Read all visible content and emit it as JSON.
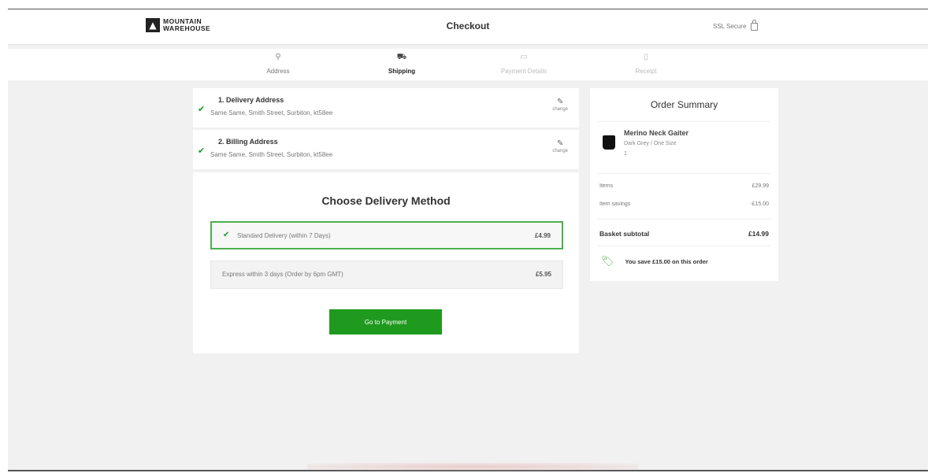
{
  "header": {
    "logo_line1": "MOUNTAIN",
    "logo_line2": "WAREHOUSE",
    "title": "Checkout",
    "secure_label": "SSL Secure"
  },
  "steps": [
    {
      "label": "Address",
      "icon": "location-pin-icon",
      "state": "done"
    },
    {
      "label": "Shipping",
      "icon": "truck-icon",
      "state": "active"
    },
    {
      "label": "Payment Details",
      "icon": "card-icon",
      "state": "inactive"
    },
    {
      "label": "Receipt",
      "icon": "receipt-icon",
      "state": "inactive"
    }
  ],
  "addresses": [
    {
      "title": "1. Delivery Address",
      "text": "Same Same, Smith Street, Surbiton, kt58ee",
      "edit": "change"
    },
    {
      "title": "2. Billing Address",
      "text": "Same Same, Smith Street, Surbiton, kt58ee",
      "edit": "change"
    }
  ],
  "delivery": {
    "title": "Choose Delivery Method",
    "options": [
      {
        "label": "Standard Delivery (within 7 Days)",
        "price": "£4.99",
        "selected": true
      },
      {
        "label": "Express within 3 days (Order by 6pm GMT)",
        "price": "£5.95",
        "selected": false
      }
    ],
    "button_label": "Go to Payment"
  },
  "summary": {
    "title": "Order Summary",
    "product": {
      "name": "Merino Neck Gaiter",
      "variant": "Dark Grey / One Size",
      "qty": "1"
    },
    "items_label": "Items",
    "items_value": "£29.99",
    "savings_label": "Item savings",
    "savings_value": "-£15.00",
    "subtotal_label": "Basket subtotal",
    "subtotal_value": "£14.99",
    "saving_message": "You save £15.00 on this order"
  },
  "colors": {
    "accent": "#1f9a1f",
    "selected_border": "#4caf50"
  }
}
